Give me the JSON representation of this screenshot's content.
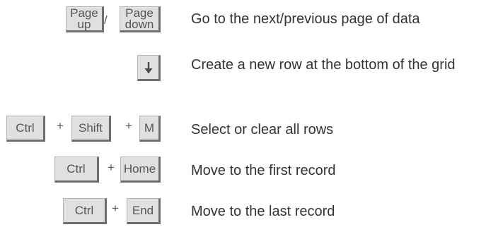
{
  "shortcuts": [
    {
      "keys": [
        "Page up",
        "Page down"
      ],
      "key_lines": [
        [
          "Page",
          "up"
        ],
        [
          "Page",
          "down"
        ]
      ],
      "separator": "/",
      "description": "Go to the next/previous page of data"
    },
    {
      "keys": [
        "down-arrow-icon"
      ],
      "description": "Create a new row at the bottom of the grid"
    },
    {
      "keys": [
        "Ctrl",
        "Shift",
        "M"
      ],
      "separator": "+",
      "description": "Select or clear all rows"
    },
    {
      "keys": [
        "Ctrl",
        "Home"
      ],
      "separator": "+",
      "description": "Move to the first record"
    },
    {
      "keys": [
        "Ctrl",
        "End"
      ],
      "separator": "+",
      "description": "Move to the last record"
    }
  ],
  "colors": {
    "key_face": "#e0e0e0",
    "key_shadow": "#6e6e6e",
    "text": "#333333"
  }
}
